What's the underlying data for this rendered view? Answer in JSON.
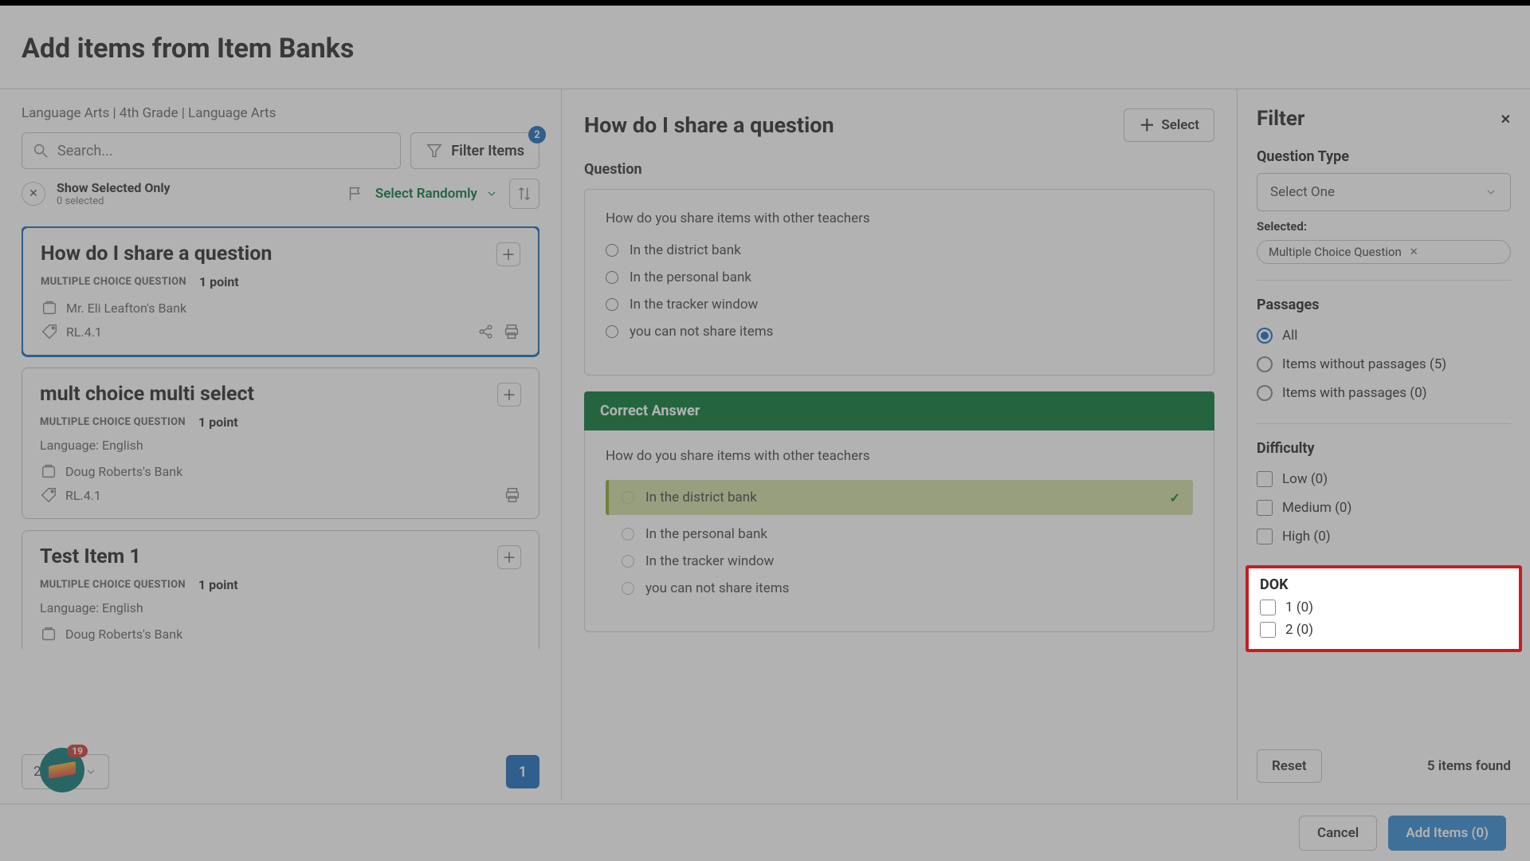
{
  "page_title": "Add items from Item Banks",
  "breadcrumb": "Language Arts | 4th Grade | Language Arts",
  "search_placeholder": "Search...",
  "filter_items_label": "Filter Items",
  "filter_badge": "2",
  "show_selected_label": "Show Selected Only",
  "selected_count": "0 selected",
  "select_random_label": "Select Randomly",
  "items": [
    {
      "title": "How do I share a question",
      "type": "MULTIPLE CHOICE QUESTION",
      "points": "1 point",
      "language": "",
      "bank": "Mr. Eli Leafton's Bank",
      "standard": "RL.4.1",
      "selected": true,
      "show_share_icon": true
    },
    {
      "title": "mult choice multi select",
      "type": "MULTIPLE CHOICE QUESTION",
      "points": "1 point",
      "language": "Language: English",
      "bank": "Doug Roberts's Bank",
      "standard": "RL.4.1",
      "selected": false,
      "show_share_icon": false
    },
    {
      "title": "Test Item 1",
      "type": "MULTIPLE CHOICE QUESTION",
      "points": "1 point",
      "language": "Language: English",
      "bank": "Doug Roberts's Bank",
      "standard": "",
      "selected": false,
      "truncated": true,
      "show_share_icon": false
    }
  ],
  "per_page": "25 Ite...",
  "page_number": "1",
  "fab_badge": "19",
  "preview": {
    "title": "How do I share a question",
    "select_label": "Select",
    "question_label": "Question",
    "question_text": "How do you share items with other teachers",
    "options": [
      "In the district bank",
      "In the personal bank",
      "In the tracker window",
      "you can not share items"
    ],
    "correct_answer_label": "Correct Answer",
    "answer_text": "How do you share items with other teachers",
    "answer_options": [
      "In the district bank",
      "In the personal bank",
      "In the tracker window",
      "you can not share items"
    ]
  },
  "filter": {
    "title": "Filter",
    "qtype_label": "Question Type",
    "qtype_placeholder": "Select One",
    "selected_label": "Selected:",
    "selected_chip": "Multiple Choice Question",
    "passages_label": "Passages",
    "passages": [
      {
        "label": "All",
        "selected": true
      },
      {
        "label": "Items without passages (5)",
        "selected": false
      },
      {
        "label": "Items with passages (0)",
        "selected": false
      }
    ],
    "difficulty_label": "Difficulty",
    "difficulty": [
      "Low (0)",
      "Medium (0)",
      "High (0)"
    ],
    "dok_label": "DOK",
    "dok": [
      "1 (0)",
      "2 (0)"
    ],
    "reset_label": "Reset",
    "found_label": "5 items found"
  },
  "footer": {
    "cancel": "Cancel",
    "add_items": "Add Items (0)"
  }
}
